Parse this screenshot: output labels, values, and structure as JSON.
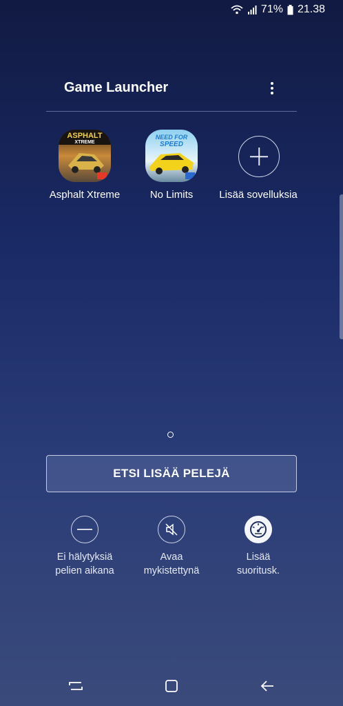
{
  "status": {
    "battery_percent": "71%",
    "time": "21.38"
  },
  "header": {
    "title": "Game Launcher"
  },
  "apps": [
    {
      "label": "Asphalt Xtreme",
      "icon": "asphalt-xtreme-icon"
    },
    {
      "label": "No Limits",
      "icon": "need-for-speed-no-limits-icon"
    },
    {
      "label": "Lisää sovelluksia",
      "icon": "plus-icon"
    }
  ],
  "find_more_button": "ETSI LISÄÄ PELEJÄ",
  "toggles": [
    {
      "label": "Ei hälytyksiä\npelien aikana",
      "icon": "do-not-disturb-icon",
      "active": false
    },
    {
      "label": "Avaa\nmykistettynä",
      "icon": "mute-icon",
      "active": false
    },
    {
      "label": "Lisää\nsuoritusk.",
      "icon": "performance-gauge-icon",
      "active": true
    }
  ],
  "icon_text": {
    "asphalt_top": "ASPHALT",
    "asphalt_sub": "XTREME",
    "nfs_top": "NEED FOR",
    "nfs_sub": "SPEED"
  },
  "colors": {
    "accent": "#1a2a66",
    "text": "#ffffff"
  }
}
